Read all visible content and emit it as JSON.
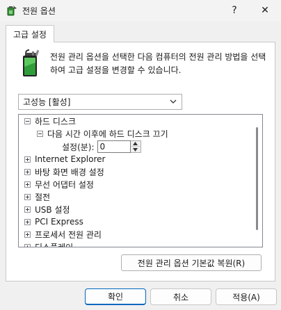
{
  "window": {
    "title": "전원 옵션",
    "help_label": "?",
    "close_label": "✕"
  },
  "tab": {
    "label": "고급 설정"
  },
  "description": "전원 관리 옵션을 선택한 다음 컴퓨터의 전원 관리 방법을 선택하여 고급 설정을 변경할 수 있습니다.",
  "plan_select": {
    "value": "고성능 [활성]"
  },
  "tree": {
    "hard_disk": "하드 디스크",
    "turn_off_after": "다음 시간 이후에 하드 디스크 끄기",
    "setting_label": "설정(분):",
    "setting_value": "0",
    "items": [
      "Internet Explorer",
      "바탕 화면 배경 설정",
      "무선 어댑터 설정",
      "절전",
      "USB 설정",
      "PCI Express",
      "프로세서 전원 관리",
      "디스플레이"
    ]
  },
  "buttons": {
    "restore_defaults": "전원 관리 옵션 기본값 복원(R)",
    "ok": "확인",
    "cancel": "취소",
    "apply": "적용(A)"
  },
  "colors": {
    "accent": "#0067c0",
    "battery_green": "#3cb043"
  }
}
